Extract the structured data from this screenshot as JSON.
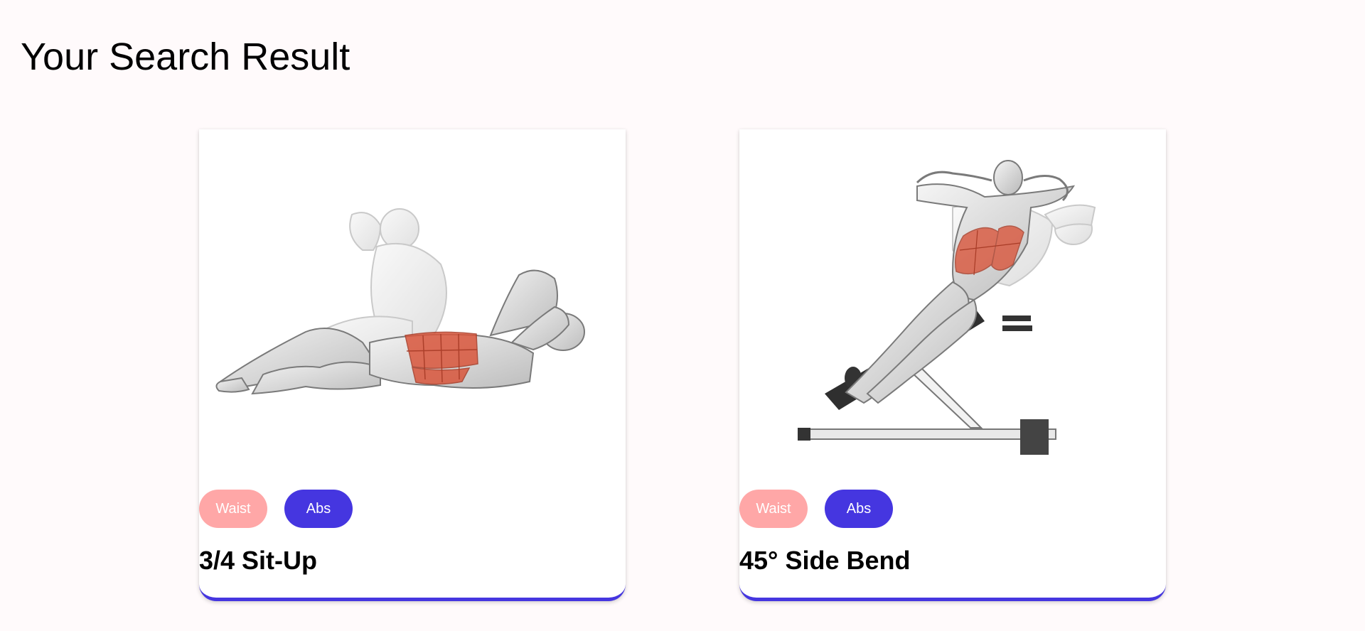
{
  "page": {
    "title": "Your Search Result"
  },
  "colors": {
    "background": "#fffafb",
    "accent": "#4536e0",
    "bodypart_tag": "#ffa7a7",
    "target_tag": "#4536e0",
    "muscle_highlight": "#d9563c"
  },
  "results": [
    {
      "name": "3/4 Sit-Up",
      "image": "sit-up-exercise-illustration",
      "bodypart": "Waist",
      "target": "Abs"
    },
    {
      "name": "45° Side Bend",
      "image": "side-bend-bench-exercise-illustration",
      "bodypart": "Waist",
      "target": "Abs"
    }
  ]
}
